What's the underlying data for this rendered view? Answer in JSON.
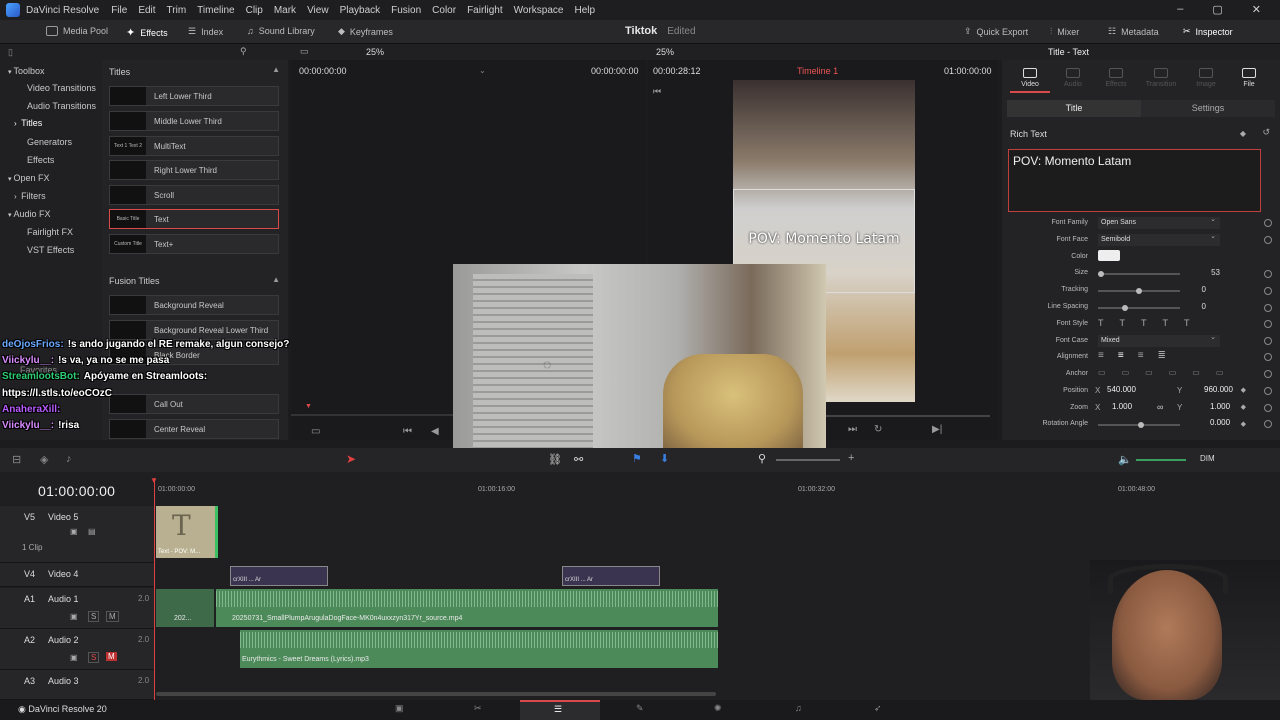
{
  "menubar": {
    "app_name": "DaVinci Resolve",
    "items": [
      "File",
      "Edit",
      "Trim",
      "Timeline",
      "Clip",
      "Mark",
      "View",
      "Playback",
      "Fusion",
      "Color",
      "Fairlight",
      "Workspace",
      "Help"
    ]
  },
  "toolbar": {
    "media_pool": "Media Pool",
    "effects": "Effects",
    "index": "Index",
    "sound_library": "Sound Library",
    "keyframes": "Keyframes",
    "project_name": "Tiktok",
    "project_status": "Edited",
    "quick_export": "Quick Export",
    "mixer": "Mixer",
    "metadata": "Metadata",
    "inspector": "Inspector"
  },
  "subbar": {
    "zoom_left": "25%",
    "zoom_right": "25%",
    "inspector_title": "Title - Text"
  },
  "toolbox": {
    "items": [
      "Toolbox",
      "Video Transitions",
      "Audio Transitions",
      "Titles",
      "Generators",
      "Effects",
      "Open FX",
      "Filters",
      "Audio FX",
      "Fairlight FX",
      "VST Effects",
      "Favorites"
    ]
  },
  "titles_panel": {
    "heading": "Titles",
    "items": [
      {
        "thumb": "",
        "label": "Left Lower Third"
      },
      {
        "thumb": "",
        "label": "Middle Lower Third"
      },
      {
        "thumb": "Text 1 Text 2",
        "label": "MultiText"
      },
      {
        "thumb": "",
        "label": "Right Lower Third"
      },
      {
        "thumb": "",
        "label": "Scroll"
      },
      {
        "thumb": "Basic Title",
        "label": "Text"
      },
      {
        "thumb": "Custom Title",
        "label": "Text+"
      }
    ],
    "fusion_heading": "Fusion Titles",
    "fusion_items": [
      {
        "label": "Background Reveal"
      },
      {
        "label": "Background Reveal Lower Third"
      },
      {
        "label": "Black Border"
      },
      {
        "label": "Call Out"
      },
      {
        "label": "Center Reveal"
      }
    ]
  },
  "source_viewer": {
    "timecode_left": "00:00:00:00",
    "timecode_right": "00:00:00:00"
  },
  "timeline_viewer": {
    "duration": "00:00:28:12",
    "timeline_name": "Timeline 1",
    "timecode": "01:00:00:00",
    "overlay_text": "POV: Momento Latam"
  },
  "inspector": {
    "tabs": [
      "Video",
      "Audio",
      "Effects",
      "Transition",
      "Image",
      "File"
    ],
    "subtabs": [
      "Title",
      "Settings"
    ],
    "section": "Rich Text",
    "rich_text": "POV: Momento Latam",
    "font_family_label": "Font Family",
    "font_family": "Open Sans",
    "font_face_label": "Font Face",
    "font_face": "Semibold",
    "color_label": "Color",
    "color": "#eeeeee",
    "size_label": "Size",
    "size": "53",
    "tracking_label": "Tracking",
    "tracking": "0",
    "line_spacing_label": "Line Spacing",
    "line_spacing": "0",
    "font_style_label": "Font Style",
    "font_case_label": "Font Case",
    "font_case": "Mixed",
    "alignment_label": "Alignment",
    "anchor_label": "Anchor",
    "position_label": "Position",
    "position_x": "540.000",
    "position_y": "960.000",
    "zoom_label": "Zoom",
    "zoom_x": "1.000",
    "zoom_y": "1.000",
    "rotation_label": "Rotation Angle",
    "rotation": "0.000",
    "x_label": "X",
    "y_label": "Y"
  },
  "timeline": {
    "timecode": "01:00:00:00",
    "ruler": [
      "01:00:00:00",
      "01:00:16:00",
      "01:00:32:00",
      "01:00:48:00"
    ],
    "volume_label": "DIM",
    "tracks": [
      {
        "id": "V5",
        "name": "Video 5",
        "info": "1 Clip"
      },
      {
        "id": "V4",
        "name": "Video 4"
      },
      {
        "id": "A1",
        "name": "Audio 1",
        "level": "2.0"
      },
      {
        "id": "A2",
        "name": "Audio 2",
        "level": "2.0"
      },
      {
        "id": "A3",
        "name": "Audio 3",
        "level": "2.0"
      }
    ],
    "clips": {
      "title_clip": "Text - POV: M...",
      "a1_short": "202...",
      "a1_clip": "20250731_SmallPlumpArugulaDogFace-MK0n4uxxzyn317Yr_source.mp4",
      "a2_clip": "Eurythmics - Sweet Dreams (Lyrics).mp3",
      "v4_clip_label": "crXIII ... Ar"
    }
  },
  "bottombar": {
    "app_version": "DaVinci Resolve 20"
  },
  "chat": [
    {
      "user": "deOjosFrios:",
      "msg": "!s ando jugando el RE remake, algun consejo?",
      "color": "#6aa9ff"
    },
    {
      "user": "Viickylu__:",
      "msg": "!s va, ya no se me pasa",
      "color": "#d98bff"
    },
    {
      "user": "StreamlootsBot:",
      "msg": "Apóyame en Streamloots:",
      "color": "#2ecc71"
    },
    {
      "user": "",
      "msg": "https://l.stls.to/eoCOzC",
      "color": "#ffffff"
    },
    {
      "user": "AnaheraXill:",
      "msg": "",
      "color": "#b85cff"
    },
    {
      "user": "Viickylu__:",
      "msg": "!risa",
      "color": "#d98bff"
    }
  ]
}
